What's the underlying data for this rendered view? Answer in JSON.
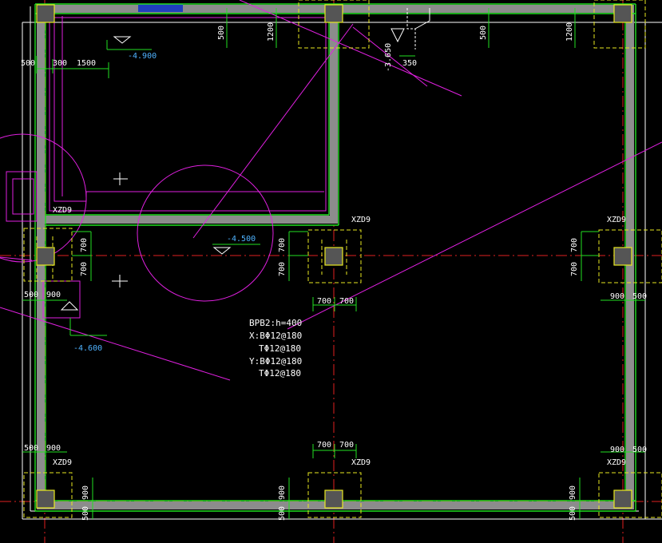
{
  "drawing": {
    "column_tag": "XZD9",
    "levels": {
      "pit_top_left": "-4.900",
      "slab_center": "-4.500",
      "slab_left": "-4.600",
      "ramp": "-3.650"
    },
    "dimensions": {
      "d300": "300",
      "d350": "350",
      "d500": "500",
      "d700": "700",
      "d900": "900",
      "d1200": "1200",
      "d1500": "1500"
    },
    "slab_note": {
      "line1": "BPB2:h=400",
      "line2": "X:BΦ12@180",
      "line3": "TΦ12@180",
      "line4": "Y:BΦ12@180",
      "line5": "TΦ12@180"
    }
  },
  "colors": {
    "background": "#000000",
    "wall": "#8c8c8c",
    "green": "#22e022",
    "magenta": "#e020e0",
    "yellow": "#e8e820",
    "red": "#e02020",
    "white": "#ffffff",
    "level_blue": "#4fb3ff"
  }
}
